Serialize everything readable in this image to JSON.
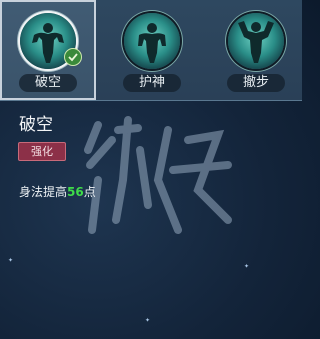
{
  "tabs": [
    {
      "label": "破空",
      "selected": true,
      "icon": "muscle-figure-icon"
    },
    {
      "label": "护神",
      "selected": false,
      "icon": "muscle-figure-icon"
    },
    {
      "label": "撤步",
      "selected": false,
      "icon": "muscle-figure-icon"
    }
  ],
  "skill": {
    "title": "破空",
    "tag": "强化",
    "desc_prefix": "身法提高",
    "desc_value": "56",
    "desc_suffix": "点"
  },
  "colors": {
    "tag_bg": "#8c3048",
    "highlight_number": "#3fdc4a",
    "accent_teal": "#2a8e88"
  }
}
